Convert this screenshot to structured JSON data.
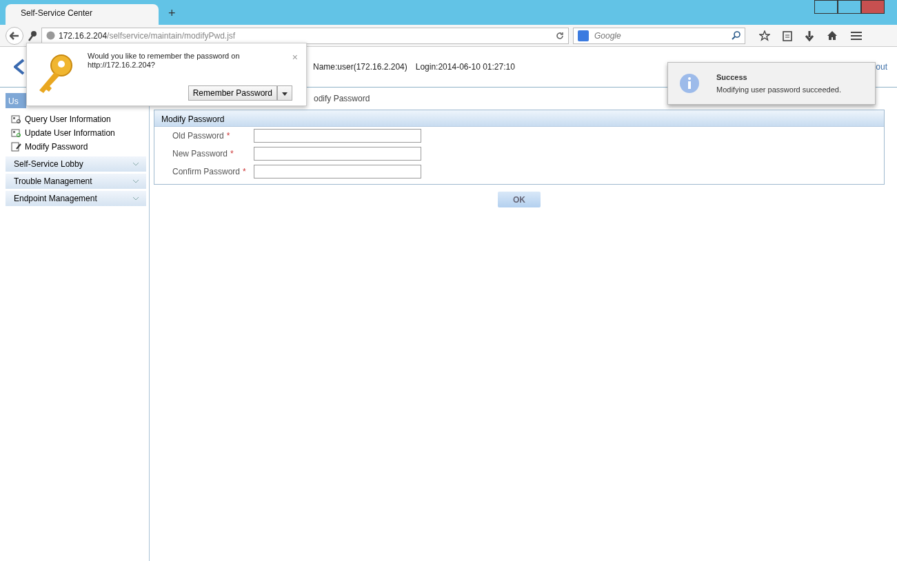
{
  "browser": {
    "tab": "Self-Service Center",
    "new_tab": "+",
    "url_host": "172.16.2.204",
    "url_path": "/selfservice/maintain/modifyPwd.jsf",
    "search_placeholder": "Google"
  },
  "header": {
    "user": "Name:user(172.16.2.204)",
    "login": "Login:2014-06-10 01:27:10",
    "logout": "out"
  },
  "breadcrumb": "odify Password",
  "sidebar": {
    "header": "Us",
    "items": [
      {
        "label": "Query User Information"
      },
      {
        "label": "Update User Information"
      },
      {
        "label": "Modify Password"
      }
    ],
    "groups": [
      {
        "label": "Self-Service Lobby",
        "expanded": false
      },
      {
        "label": "Trouble Management",
        "expanded": false
      },
      {
        "label": "Endpoint Management",
        "expanded": false
      }
    ]
  },
  "form": {
    "title": "Modify Password",
    "fields": [
      {
        "label": "Old Password",
        "required": "*"
      },
      {
        "label": "New Password",
        "required": "*"
      },
      {
        "label": "Confirm Password",
        "required": "*"
      }
    ],
    "ok": "OK"
  },
  "password_prompt": {
    "message": "Would you like to remember the password on",
    "site": "http://172.16.2.204?",
    "close": "×",
    "button": "Remember Password"
  },
  "toast": {
    "title": "Success",
    "message": "Modifying user password succeeded."
  }
}
